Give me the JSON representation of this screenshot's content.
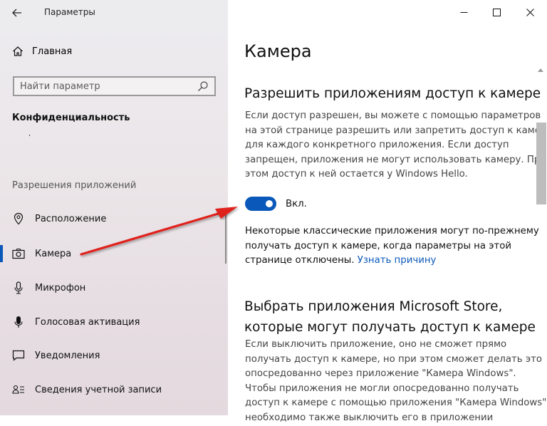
{
  "window": {
    "title": "Параметры",
    "controls": [
      "minimize-icon",
      "maximize-icon",
      "close-icon"
    ]
  },
  "sidebar": {
    "home_label": "Главная",
    "search": {
      "placeholder": "Найти параметр"
    },
    "section_title": "Конфиденциальность",
    "cut_item_label": "Разрешения Windows",
    "group_title": "Разрешения приложений",
    "items": [
      {
        "label": "Расположение",
        "icon": "location-icon",
        "selected": false
      },
      {
        "label": "Камера",
        "icon": "camera-icon",
        "selected": true
      },
      {
        "label": "Микрофон",
        "icon": "microphone-icon",
        "selected": false
      },
      {
        "label": "Голосовая активация",
        "icon": "voice-activation-icon",
        "selected": false
      },
      {
        "label": "Уведомления",
        "icon": "notifications-icon",
        "selected": false
      },
      {
        "label": "Сведения учетной записи",
        "icon": "account-info-icon",
        "selected": false
      }
    ]
  },
  "main": {
    "title": "Камера",
    "section1": {
      "heading": "Разрешить приложениям доступ к камере",
      "description_lines": [
        "Если доступ разрешен, вы можете с помощью параметров",
        "на этой странице разрешить или запретить доступ к камере",
        "для каждого конкретного приложения. Если доступ",
        "запрещен, приложения не могут использовать камеру. При",
        "этом доступ к ней остается у Windows Hello."
      ],
      "toggle": {
        "state": "on",
        "label": "Вкл."
      },
      "note_lines": [
        "Некоторые классические приложения могут по-прежнему",
        "получать доступ к камере, когда параметры на этой",
        "странице отключены."
      ],
      "note_link": "Узнать причину"
    },
    "section2": {
      "heading_lines": [
        "Выбрать приложения Microsoft Store,",
        "которые могут получать доступ к камере"
      ],
      "description_lines": [
        "Если выключить приложение, оно не сможет прямо",
        "получать доступ к камере, но при этом сможет делать это",
        "опосредованно через приложение \"Камера Windows\".",
        "Чтобы приложения не могли опосредованно получать",
        "доступ к камере с помощью приложения \"Камера Windows\",",
        "необходимо также выключить его в приложении"
      ]
    }
  },
  "colors": {
    "accent": "#0a58b9",
    "annotation_arrow": "#e0201f"
  }
}
